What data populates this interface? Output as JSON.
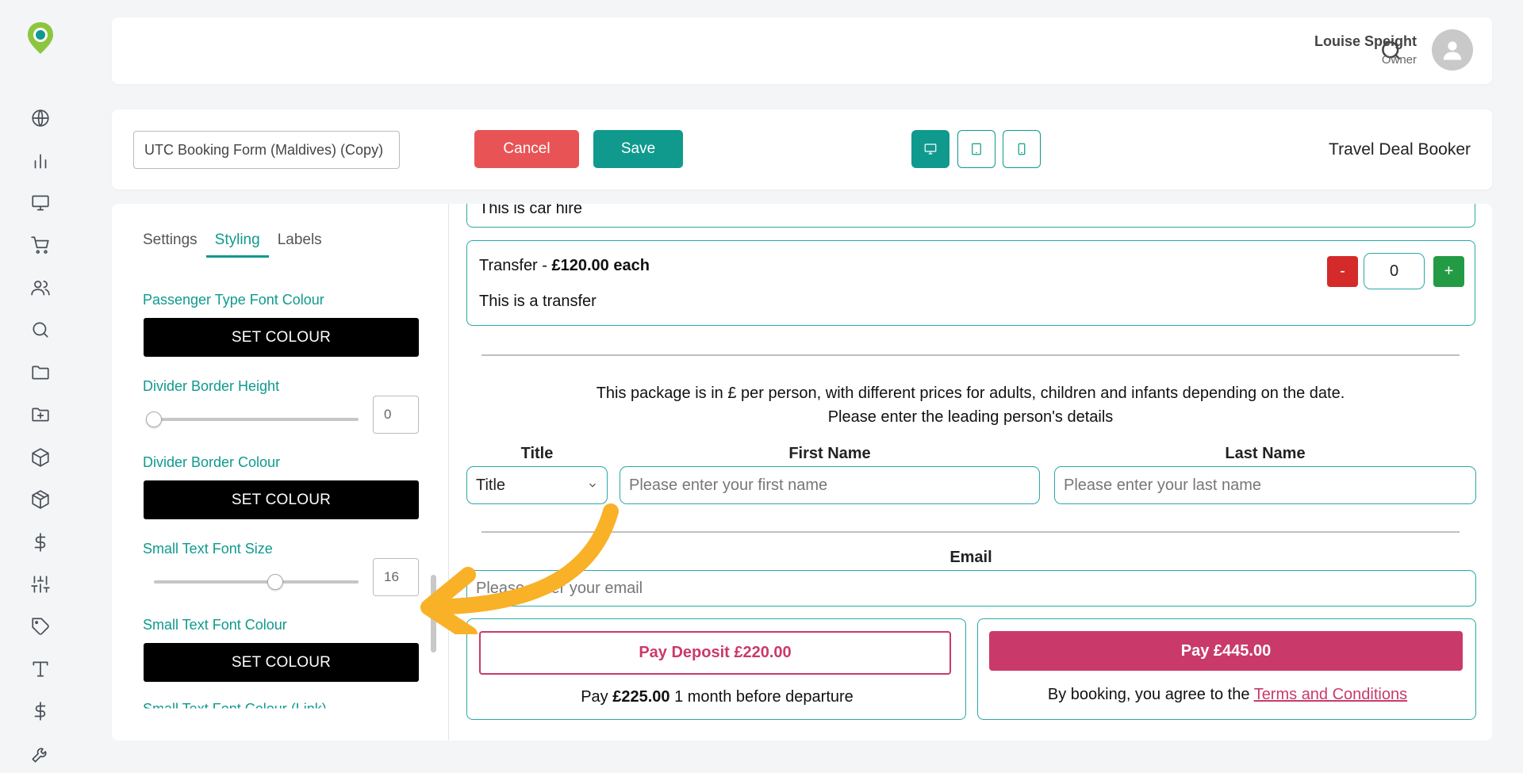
{
  "header": {
    "user_name": "Louise Speight",
    "user_role": "Owner"
  },
  "toolbar": {
    "form_name": "UTC Booking Form (Maldives) (Copy)",
    "cancel_label": "Cancel",
    "save_label": "Save",
    "product_title": "Travel Deal Booker",
    "devices": [
      "desktop",
      "tablet",
      "mobile"
    ],
    "active_device": "desktop"
  },
  "sidebar": {
    "icons": [
      "globe-icon",
      "bar-chart-icon",
      "monitor-icon",
      "cart-icon",
      "users-icon",
      "search-icon",
      "folder-icon",
      "folder-plus-icon",
      "box-icon",
      "package-icon",
      "dollar-icon",
      "sliders-icon",
      "tag-icon",
      "type-icon",
      "dollar-icon",
      "wrench-icon"
    ]
  },
  "panel": {
    "tabs": [
      "Settings",
      "Styling",
      "Labels"
    ],
    "active_tab": "Styling",
    "passenger_type_font_colour_label": "Passenger Type Font Colour",
    "set_colour_label": "SET COLOUR",
    "divider_border_height_label": "Divider Border Height",
    "divider_border_height_value": "0",
    "divider_border_colour_label": "Divider Border Colour",
    "small_text_font_size_label": "Small Text Font Size",
    "small_text_font_size_value": "16",
    "small_text_font_colour_label": "Small Text Font Colour",
    "small_text_font_colour_link_label": "Small Text Font Colour (Link)"
  },
  "preview": {
    "car_hire_text": "This is car hire",
    "transfer_name": "Transfer - ",
    "transfer_price": "£120.00 each",
    "transfer_desc": "This is a transfer",
    "qty_minus": "-",
    "qty_value": "0",
    "qty_plus": "+",
    "info_line1": "This package is in £ per person, with different prices for adults, children and infants depending on the date.",
    "info_line2": "Please enter the leading person's details",
    "title_label": "Title",
    "title_value": "Title",
    "first_name_label": "First Name",
    "first_name_placeholder": "Please enter your first name",
    "last_name_label": "Last Name",
    "last_name_placeholder": "Please enter your last name",
    "email_label": "Email",
    "email_placeholder": "Please enter your email",
    "pay_deposit_label": "Pay Deposit £220.00",
    "deposit_note_pre": "Pay ",
    "deposit_note_amount": "£225.00",
    "deposit_note_post": " 1 month before departure",
    "pay_full_label": "Pay £445.00",
    "terms_pre": "By booking, you agree to the ",
    "terms_link": "Terms and Conditions"
  },
  "colors": {
    "brand_teal": "#0f9a8d",
    "cancel_red": "#e85456",
    "pay_pink": "#c93a6b",
    "annotation_arrow": "#f9b128"
  }
}
